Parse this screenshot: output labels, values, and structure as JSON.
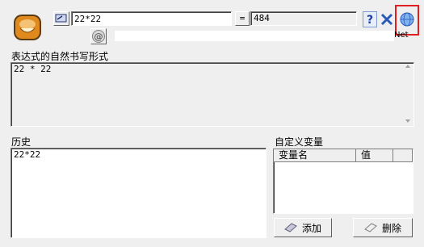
{
  "expression_input": {
    "value": "22*22"
  },
  "equals_label": "=",
  "result_output": {
    "value": "484"
  },
  "natural_form": {
    "label": "表达式的自然书写形式",
    "text": "22 * 22"
  },
  "history": {
    "label": "历史",
    "items": [
      "22*22"
    ]
  },
  "variables": {
    "label": "自定义变量",
    "columns": [
      "变量名",
      "值"
    ],
    "add_button": "添加",
    "delete_button": "删除"
  },
  "net_label": "Net",
  "icons": {
    "app": "calculator-face-icon",
    "edit": "edit-frame-icon",
    "at": "at-sign-icon",
    "help": "help-icon",
    "close": "close-icon",
    "web": "globe-icon"
  },
  "colors": {
    "highlight": "#e02020",
    "app_orange": "#e08a1e"
  }
}
